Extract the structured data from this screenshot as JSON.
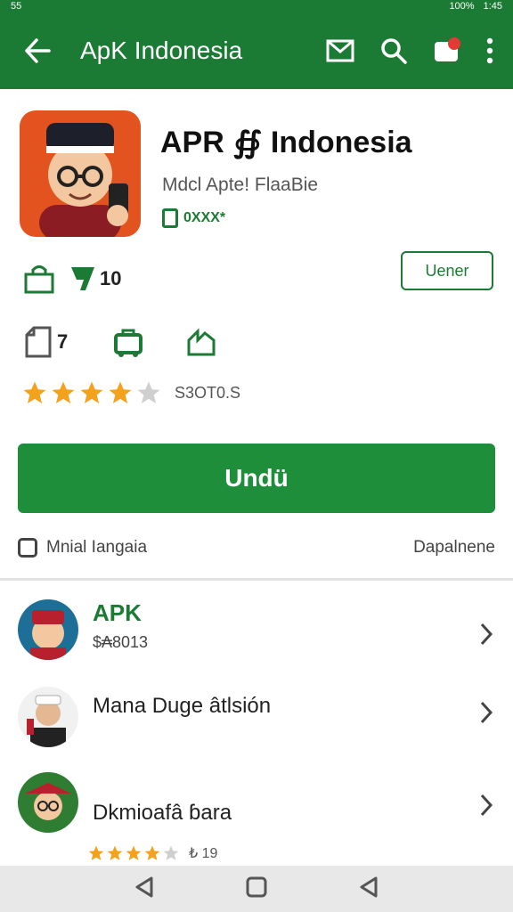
{
  "status_bar": {
    "left": "55",
    "battery": "100%",
    "time": "1:45"
  },
  "app_bar": {
    "title": "ApK Indonesia"
  },
  "app": {
    "title": "APR ∯ Indonesia",
    "subtitle": "Mdcl Apte! FlaaBie",
    "badge": "0XXX*"
  },
  "stats": {
    "first_count": "10",
    "update_label": "Uener",
    "files_count": "7",
    "rating_value": 4,
    "rating_text": "S3ΟΤ0.S"
  },
  "install_label": "Undü",
  "footer": {
    "left": "Mnial Iangaia",
    "right": "Dapalnene"
  },
  "list": [
    {
      "name": "APK",
      "sub": "$₳8013"
    },
    {
      "name": "Mana Duge âtlsión",
      "sub": ""
    },
    {
      "name": "Dkmioafâ ɓara",
      "sub": ""
    }
  ],
  "item_rating": {
    "value": 4,
    "text": "₺ 19"
  },
  "colors": {
    "brand": "#1b7a33",
    "button": "#1e8e3a",
    "star": "#f4a11b"
  }
}
